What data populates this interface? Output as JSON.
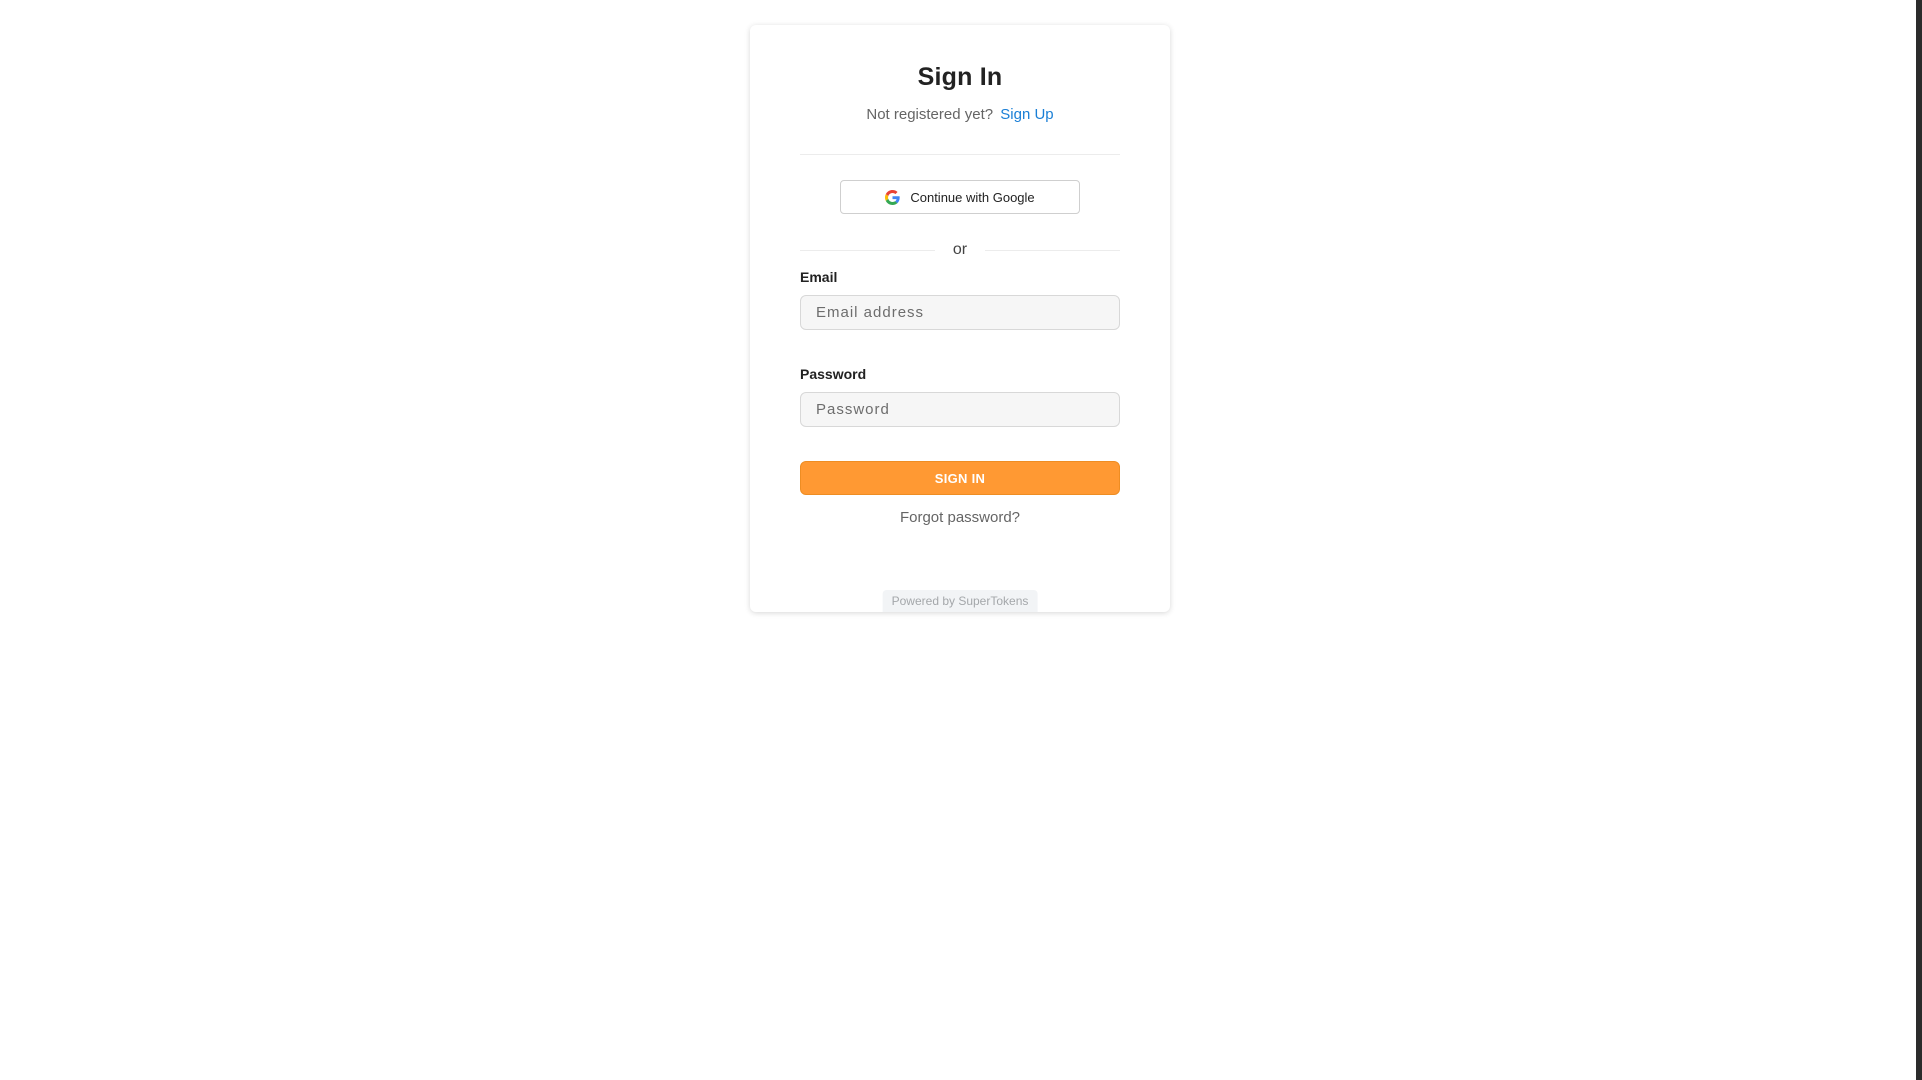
{
  "card": {
    "title": "Sign In",
    "subtitle_prefix": "Not registered yet?",
    "signup_link": "Sign Up"
  },
  "google": {
    "label": "Continue with Google",
    "icon": "google-icon"
  },
  "separator": {
    "label": "or"
  },
  "form": {
    "email": {
      "label": "Email",
      "placeholder": "Email address",
      "value": ""
    },
    "password": {
      "label": "Password",
      "placeholder": "Password",
      "value": ""
    },
    "submit_label": "SIGN IN",
    "forgot_label": "Forgot password?"
  },
  "footer": {
    "powered_by": "Powered by SuperTokens"
  },
  "colors": {
    "primary": "#ff9933",
    "link": "#1a7fd6",
    "background": "#ffffff"
  }
}
